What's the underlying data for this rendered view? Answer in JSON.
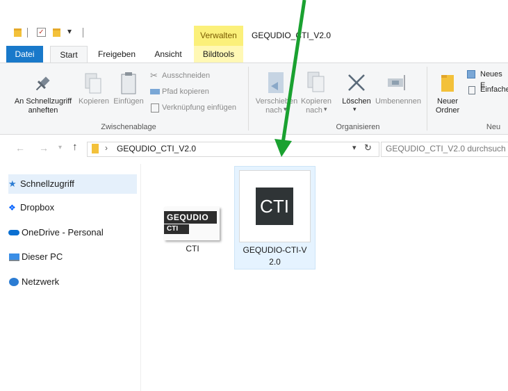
{
  "window": {
    "title": "GEQUDIO_CTI_V2.0",
    "contextual_group": "Verwalten"
  },
  "ribbon_tabs": [
    "Datei",
    "Start",
    "Freigeben",
    "Ansicht",
    "Bildtools"
  ],
  "clipboard": {
    "pin_label_1": "An Schnellzugriff",
    "pin_label_2": "anheften",
    "copy_label": "Kopieren",
    "paste_label": "Einfügen",
    "cut_label": "Ausschneiden",
    "copy_path_label": "Pfad kopieren",
    "paste_shortcut_label": "Verknüpfung einfügen",
    "group_label": "Zwischenablage"
  },
  "organize": {
    "move_label_1": "Verschieben",
    "move_label_2": "nach",
    "copyto_label_1": "Kopieren",
    "copyto_label_2": "nach",
    "delete_label": "Löschen",
    "rename_label": "Umbenennen",
    "group_label": "Organisieren"
  },
  "new": {
    "new_folder_label_1": "Neuer",
    "new_folder_label_2": "Ordner",
    "new_item_label": "Neues E",
    "easy_access_label": "Einfache",
    "group_label": "Neu"
  },
  "address": {
    "path_segment": "GEQUDIO_CTI_V2.0",
    "search_placeholder": "GEQUDIO_CTI_V2.0 durchsuch"
  },
  "sidebar": {
    "items": [
      {
        "label": "Schnellzugriff",
        "icon": "star-icon"
      },
      {
        "label": "Dropbox",
        "icon": "dropbox-icon"
      },
      {
        "label": "OneDrive - Personal",
        "icon": "cloud-icon"
      },
      {
        "label": "Dieser PC",
        "icon": "pc-icon"
      },
      {
        "label": "Netzwerk",
        "icon": "network-icon"
      }
    ]
  },
  "files": [
    {
      "name": "CTI",
      "logo_top": "GEQUDIO",
      "logo_bottom": "CTI"
    },
    {
      "name_line1": "GEQUDIO-CTI-V",
      "name_line2": "2.0",
      "thumb_text": "CTI"
    }
  ],
  "colors": {
    "accent": "#1979ca",
    "contextual": "#fbf07a",
    "arrow": "#1aa130",
    "selection": "#e5f3ff"
  }
}
